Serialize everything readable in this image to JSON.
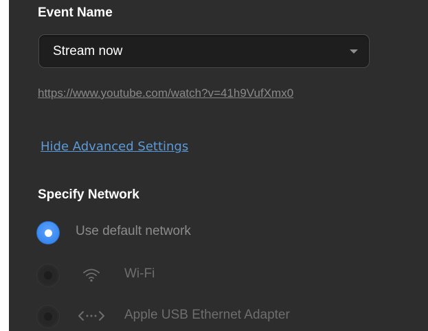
{
  "event": {
    "label": "Event Name",
    "selected_value": "Stream now",
    "url": "https://www.youtube.com/watch?v=41h9VufXmx0"
  },
  "advanced_link": "Hide Advanced Settings",
  "network": {
    "label": "Specify Network",
    "options": [
      {
        "label": "Use default network",
        "selected": true,
        "icon": ""
      },
      {
        "label": "Wi-Fi",
        "selected": false,
        "icon": "wifi-icon"
      },
      {
        "label": "Apple USB Ethernet Adapter",
        "selected": false,
        "icon": "ethernet-icon"
      }
    ]
  },
  "colors": {
    "panel_bg": "#2d2d2d",
    "accent": "#2d7de8",
    "link": "#5b9bd9"
  }
}
